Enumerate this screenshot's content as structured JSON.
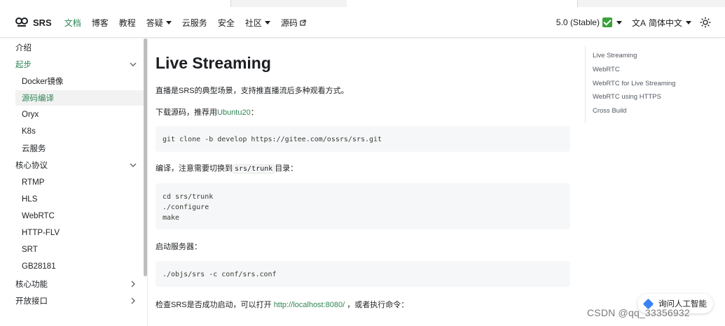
{
  "navbar": {
    "brand": "SRS",
    "items": [
      {
        "label": "文档",
        "active": true,
        "caret": false,
        "external": false
      },
      {
        "label": "博客",
        "active": false,
        "caret": false,
        "external": false
      },
      {
        "label": "教程",
        "active": false,
        "caret": false,
        "external": false
      },
      {
        "label": "答疑",
        "active": false,
        "caret": true,
        "external": false
      },
      {
        "label": "云服务",
        "active": false,
        "caret": false,
        "external": false
      },
      {
        "label": "安全",
        "active": false,
        "caret": false,
        "external": false
      },
      {
        "label": "社区",
        "active": false,
        "caret": true,
        "external": false
      },
      {
        "label": "源码",
        "active": false,
        "caret": false,
        "external": true
      }
    ],
    "version": "5.0 (Stable)",
    "language": "简体中文",
    "accent": "#2e8555"
  },
  "sidebar": {
    "items": [
      {
        "label": "介绍",
        "level": "cat",
        "expanded": null,
        "state": "normal"
      },
      {
        "label": "起步",
        "level": "cat",
        "expanded": true,
        "state": "green"
      },
      {
        "label": "Docker镜像",
        "level": "sub",
        "expanded": null,
        "state": "normal"
      },
      {
        "label": "源码编译",
        "level": "sub",
        "expanded": null,
        "state": "selected"
      },
      {
        "label": "Oryx",
        "level": "sub",
        "expanded": null,
        "state": "normal"
      },
      {
        "label": "K8s",
        "level": "sub",
        "expanded": null,
        "state": "normal"
      },
      {
        "label": "云服务",
        "level": "sub",
        "expanded": null,
        "state": "normal"
      },
      {
        "label": "核心协议",
        "level": "cat",
        "expanded": true,
        "state": "normal"
      },
      {
        "label": "RTMP",
        "level": "sub",
        "expanded": null,
        "state": "normal"
      },
      {
        "label": "HLS",
        "level": "sub",
        "expanded": null,
        "state": "normal"
      },
      {
        "label": "WebRTC",
        "level": "sub",
        "expanded": null,
        "state": "normal"
      },
      {
        "label": "HTTP-FLV",
        "level": "sub",
        "expanded": null,
        "state": "normal"
      },
      {
        "label": "SRT",
        "level": "sub",
        "expanded": null,
        "state": "normal"
      },
      {
        "label": "GB28181",
        "level": "sub",
        "expanded": null,
        "state": "normal"
      },
      {
        "label": "核心功能",
        "level": "cat",
        "expanded": false,
        "state": "normal"
      },
      {
        "label": "开放接口",
        "level": "cat",
        "expanded": false,
        "state": "normal"
      }
    ]
  },
  "content": {
    "title": "Live Streaming",
    "intro": "直播是SRS的典型场景，支持推直播流后多种观看方式。",
    "download_prefix": "下载源码，推荐用",
    "download_link": "Ubuntu20",
    "download_suffix": "：",
    "code1": "git clone -b develop https://gitee.com/ossrs/srs.git",
    "compile_prefix": "编译，注意需要切换到",
    "compile_code": "srs/trunk",
    "compile_suffix": "目录：",
    "code2": "cd srs/trunk\n./configure\nmake",
    "start_text": "启动服务器：",
    "code3": "./objs/srs -c conf/srs.conf",
    "check_prefix": "检查SRS是否成功启动，可以打开 ",
    "check_link": "http://localhost:8080/",
    "check_suffix": " ，或者执行命令："
  },
  "toc": {
    "items": [
      "Live Streaming",
      "WebRTC",
      "WebRTC for Live Streaming",
      "WebRTC using HTTPS",
      "Cross Build"
    ]
  },
  "ai_button": {
    "label": "询问人工智能"
  },
  "watermark": "CSDN @qq_33356932"
}
